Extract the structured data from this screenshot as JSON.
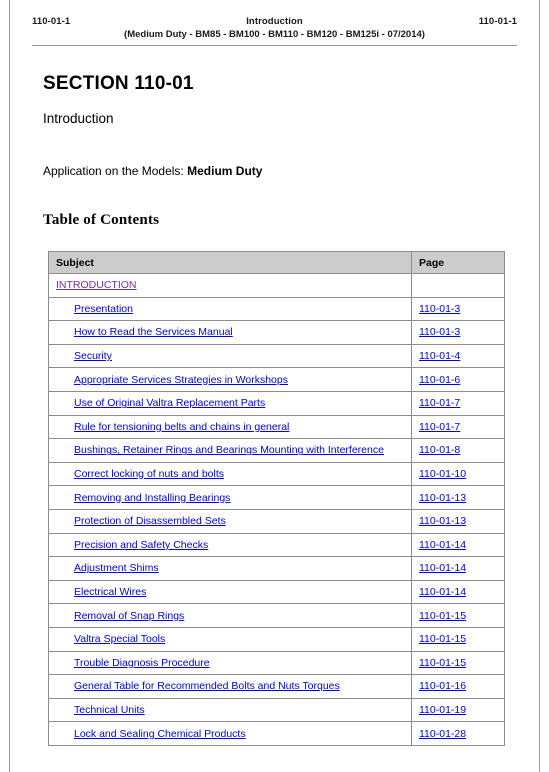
{
  "header": {
    "left_code": "110-01-1",
    "center_title": "Introduction",
    "right_code": "110-01-1",
    "subtitle": "(Medium Duty - BM85 - BM100 - BM110 - BM120 - BM125i - 07/2014)"
  },
  "document": {
    "section_title": "SECTION 110-01",
    "section_subtitle": "Introduction",
    "application_label": "Application on the Models:",
    "application_model": "Medium Duty",
    "toc_heading": "Table of Contents"
  },
  "toc": {
    "columns": {
      "subject": "Subject",
      "page": "Page"
    },
    "rows": [
      {
        "type": "group",
        "label": "INTRODUCTION",
        "page": "",
        "visited": true
      },
      {
        "type": "item",
        "label": "Presentation",
        "page": "110-01-3"
      },
      {
        "type": "item",
        "label": "How to Read the Services Manual",
        "page": "110-01-3"
      },
      {
        "type": "item",
        "label": "Security",
        "page": "110-01-4"
      },
      {
        "type": "item",
        "label": "Appropriate Services Strategies in Workshops",
        "page": "110-01-6"
      },
      {
        "type": "item",
        "label": "Use of Original Valtra Replacement Parts",
        "page": "110-01-7"
      },
      {
        "type": "item",
        "label": "Rule for tensioning belts and chains in general",
        "page": "110-01-7"
      },
      {
        "type": "item",
        "label": "Bushings, Retainer Rings and Bearings Mounting with Interference",
        "page": "110-01-8"
      },
      {
        "type": "item",
        "label": "Correct locking of nuts and bolts",
        "page": "110-01-10"
      },
      {
        "type": "item",
        "label": "Removing and Installing Bearings",
        "page": "110-01-13"
      },
      {
        "type": "item",
        "label": "Protection of Disassembled Sets",
        "page": "110-01-13"
      },
      {
        "type": "item",
        "label": "Precision and Safety Checks",
        "page": "110-01-14"
      },
      {
        "type": "item",
        "label": "Adjustment Shims",
        "page": "110-01-14"
      },
      {
        "type": "item",
        "label": "Electrical Wires",
        "page": "110-01-14"
      },
      {
        "type": "item",
        "label": "Removal of Snap Rings",
        "page": "110-01-15"
      },
      {
        "type": "item",
        "label": "Valtra Special Tools",
        "page": "110-01-15"
      },
      {
        "type": "item",
        "label": "Trouble Diagnosis Procedure",
        "page": "110-01-15"
      },
      {
        "type": "item",
        "label": "General Table for Recommended Bolts and Nuts Torques",
        "page": "110-01-16"
      },
      {
        "type": "item",
        "label": "Technical Units",
        "page": "110-01-19"
      },
      {
        "type": "item",
        "label": "Lock and Sealing Chemical Products",
        "page": "110-01-28"
      }
    ]
  },
  "colors": {
    "link": "#0000ee",
    "visited_link": "#7a2ea8",
    "table_header_bg": "#cccccc",
    "border": "#8d8d8d"
  }
}
